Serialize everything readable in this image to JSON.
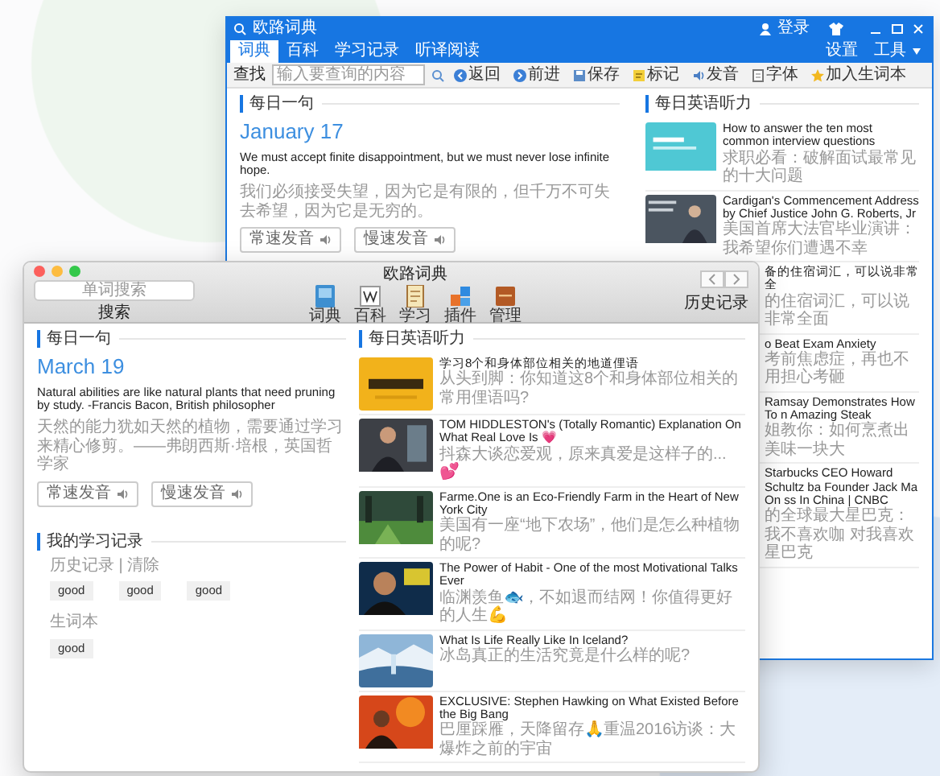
{
  "back_window": {
    "title": "欧路词典",
    "login": "登录",
    "tabs": [
      {
        "label": "词典",
        "selected": true
      },
      {
        "label": "百科",
        "selected": false
      },
      {
        "label": "学习记录",
        "selected": false
      },
      {
        "label": "听译阅读",
        "selected": false
      }
    ],
    "menus": [
      "设置",
      "工具"
    ],
    "toolbar": {
      "search_label": "查找",
      "placeholder": "输入要查询的内容",
      "buttons": [
        {
          "label": "返回",
          "kind": "back"
        },
        {
          "label": "前进",
          "kind": "forward"
        },
        {
          "label": "保存",
          "kind": "save"
        },
        {
          "label": "标记",
          "kind": "mark"
        },
        {
          "label": "发音",
          "kind": "sound"
        },
        {
          "label": "字体",
          "kind": "font"
        },
        {
          "label": "加入生词本",
          "kind": "star"
        }
      ]
    },
    "daily_sentence": {
      "heading": "每日一句",
      "date": "January 17",
      "english": "We must accept finite disappointment, but we must never lose infinite hope.",
      "chinese": "我们必须接受失望，因为它是有限的，但千万不可失去希望，因为它是无穷的。",
      "buttons": [
        "常速发音",
        "慢速发音"
      ]
    },
    "listening": {
      "heading": "每日英语听力",
      "items": [
        {
          "kind": "full",
          "title": "How to answer the ten most common interview questions",
          "subtitle": "求职必看：破解面试最常见的十大问题"
        },
        {
          "kind": "full",
          "title": "Cardigan's Commencement Address by Chief Justice John G. Roberts, Jr",
          "subtitle": "美国首席大法官毕业演讲：我希望你们遭遇不幸"
        },
        {
          "kind": "partial",
          "title": "备的住宿词汇，可以说非常全",
          "subtitle": "的住宿词汇，可以说非常全面"
        },
        {
          "kind": "partial",
          "title": "o Beat Exam Anxiety",
          "subtitle": "考前焦虑症，再也不用担心考砸"
        },
        {
          "kind": "partial",
          "title": "Ramsay Demonstrates How To n Amazing Steak",
          "subtitle": "姐教你：如何烹煮出美味一块大"
        },
        {
          "kind": "partial",
          "title": "Starbucks CEO Howard Schultz ba Founder Jack Ma On ss In China | CNBC",
          "subtitle": "的全球最大星巴克：我不喜欢咖 对我喜欢星巴克"
        }
      ]
    }
  },
  "front_window": {
    "title": "欧路词典",
    "search": {
      "placeholder": "单词搜索",
      "label": "搜索"
    },
    "toolbar": [
      {
        "label": "词典",
        "kind": "dictionary"
      },
      {
        "label": "百科",
        "kind": "wiki"
      },
      {
        "label": "学习",
        "kind": "study"
      },
      {
        "label": "插件",
        "kind": "plugin"
      },
      {
        "label": "管理",
        "kind": "manage"
      }
    ],
    "history_label": "历史记录",
    "daily_sentence": {
      "heading": "每日一句",
      "date": "March 19",
      "english": "Natural abilities are like natural plants that need pruning by study. -Francis Bacon, British philosopher",
      "chinese": "天然的能力犹如天然的植物，需要通过学习来精心修剪。——弗朗西斯·培根，英国哲学家",
      "buttons": [
        "常速发音",
        "慢速发音"
      ]
    },
    "study_record": {
      "heading": "我的学习记录",
      "history_label": "历史记录 | 清除",
      "history_words": [
        "good",
        "good",
        "good"
      ],
      "wordbook_label": "生词本",
      "wordbook_words": [
        "good"
      ]
    },
    "listening": {
      "heading": "每日英语听力",
      "items": [
        {
          "title": "学习8个和身体部位相关的地道俚语",
          "subtitle": "从头到脚：你知道这8个和身体部位相关的常用俚语吗?"
        },
        {
          "title": "TOM HIDDLESTON's (Totally Romantic) Explanation On What Real Love Is 💗",
          "subtitle": "抖森大谈恋爱观，原来真爱是这样子的...💕"
        },
        {
          "title": "Farme.One is an Eco-Friendly Farm in the Heart of New York City",
          "subtitle": "美国有一座“地下农场”，他们是怎么种植物的呢?"
        },
        {
          "title": "The Power of Habit - One of the most Motivational Talks Ever",
          "subtitle": "临渊羡鱼🐟，不如退而结网！你值得更好的人生💪"
        },
        {
          "title": "What Is Life Really Like In Iceland?",
          "subtitle": "冰岛真正的生活究竟是什么样的呢?"
        },
        {
          "title": "EXCLUSIVE: Stephen Hawking on What Existed Before the Big Bang",
          "subtitle": "巴厘踩雁，天降留存🙏重温2016访谈：大爆炸之前的宇宙"
        }
      ]
    }
  }
}
